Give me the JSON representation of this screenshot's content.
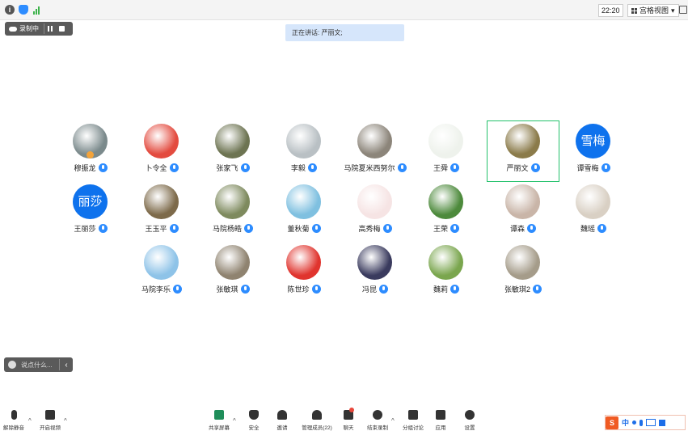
{
  "topbar": {
    "time": "22:20",
    "view_label": "宫格视图",
    "view_caret": "▾"
  },
  "recording": {
    "label": "录制中"
  },
  "speaker_banner": "正在讲话: 严丽文;",
  "participants": [
    {
      "name": "穆振龙",
      "avatar": "photo",
      "color": "#7b8a8c"
    },
    {
      "name": "卜令全",
      "avatar": "photo",
      "color": "#e34b3f"
    },
    {
      "name": "张家飞",
      "avatar": "photo",
      "color": "#6d7452"
    },
    {
      "name": "李毅",
      "avatar": "photo",
      "color": "#b9c0c4"
    },
    {
      "name": "马院夏米西努尔",
      "avatar": "photo",
      "color": "#8c857a"
    },
    {
      "name": "王舜",
      "avatar": "photo",
      "color": "#eef2ec"
    },
    {
      "name": "严丽文",
      "avatar": "photo",
      "color": "#8b7b4a"
    },
    {
      "name": "谭雪梅",
      "avatar": "text",
      "initials": "雪梅"
    },
    {
      "name": "王丽莎",
      "avatar": "text",
      "initials": "丽莎"
    },
    {
      "name": "王玉平",
      "avatar": "photo",
      "color": "#7d6a4a"
    },
    {
      "name": "马院杨皓",
      "avatar": "photo",
      "color": "#7e8a5e"
    },
    {
      "name": "董秋菊",
      "avatar": "photo",
      "color": "#7fc0e0"
    },
    {
      "name": "高秀梅",
      "avatar": "photo",
      "color": "#f6e4e4"
    },
    {
      "name": "王荣",
      "avatar": "photo",
      "color": "#4d8a3c"
    },
    {
      "name": "谭森",
      "avatar": "photo",
      "color": "#c9b5a8"
    },
    {
      "name": "魏瑶",
      "avatar": "photo",
      "color": "#d9d0c4"
    },
    {
      "name": "马院李乐",
      "avatar": "photo",
      "color": "#8ec3e8"
    },
    {
      "name": "张敏琪",
      "avatar": "photo",
      "color": "#8f8370"
    },
    {
      "name": "陈世珍",
      "avatar": "photo",
      "color": "#e0342e"
    },
    {
      "name": "冯昆",
      "avatar": "photo",
      "color": "#3a3b5e"
    },
    {
      "name": "魏莉",
      "avatar": "photo",
      "color": "#7aa64e"
    },
    {
      "name": "张敏琪2",
      "avatar": "photo",
      "color": "#a59c8a"
    }
  ],
  "chat_input": {
    "placeholder": "说点什么..."
  },
  "toolbar": {
    "unmute": "解除静音",
    "start_video": "开启视频",
    "share_screen": "共享屏幕",
    "security": "安全",
    "invite": "邀请",
    "participants": "管理成员(22)",
    "chat": "聊天",
    "end_recording": "结束录制",
    "breakout": "分组讨论",
    "apps": "应用",
    "settings": "设置"
  },
  "ime": {
    "lang": "中"
  }
}
